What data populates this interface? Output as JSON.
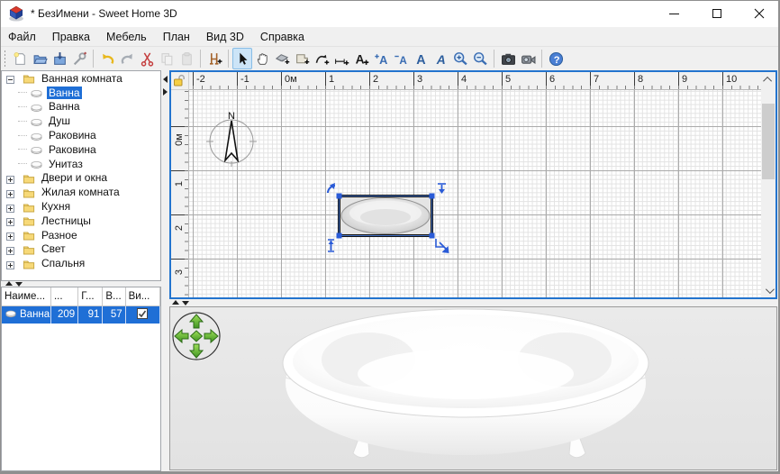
{
  "window": {
    "title": "* БезИмени - Sweet Home 3D"
  },
  "titlebar_controls": [
    {
      "name": "minimize-button",
      "icon": "minimize-icon"
    },
    {
      "name": "maximize-button",
      "icon": "maximize-icon"
    },
    {
      "name": "close-button",
      "icon": "close-icon"
    }
  ],
  "menu": {
    "items": [
      {
        "name": "menu-file",
        "label": "Файл"
      },
      {
        "name": "menu-edit",
        "label": "Правка"
      },
      {
        "name": "menu-furniture",
        "label": "Мебель"
      },
      {
        "name": "menu-plan",
        "label": "План"
      },
      {
        "name": "menu-view3d",
        "label": "Вид 3D"
      },
      {
        "name": "menu-help",
        "label": "Справка"
      }
    ]
  },
  "toolbar": {
    "buttons": [
      {
        "name": "new-home-button",
        "icon": "new-document-icon"
      },
      {
        "name": "open-home-button",
        "icon": "open-folder-icon"
      },
      {
        "name": "save-home-button",
        "icon": "save-icon"
      },
      {
        "name": "preferences-button",
        "icon": "preferences-icon"
      },
      {
        "separator": true
      },
      {
        "name": "undo-button",
        "icon": "undo-icon"
      },
      {
        "name": "redo-button",
        "icon": "redo-icon"
      },
      {
        "name": "cut-button",
        "icon": "cut-icon"
      },
      {
        "name": "copy-button",
        "icon": "copy-icon",
        "disabled": true
      },
      {
        "name": "paste-button",
        "icon": "paste-icon",
        "disabled": true
      },
      {
        "separator": true
      },
      {
        "name": "add-furniture-button",
        "icon": "add-furniture-icon"
      },
      {
        "separator": true
      },
      {
        "name": "select-tool-button",
        "icon": "select-arrow-icon",
        "active": true
      },
      {
        "name": "pan-tool-button",
        "icon": "pan-hand-icon"
      },
      {
        "name": "create-walls-button",
        "icon": "create-walls-icon"
      },
      {
        "name": "create-rooms-button",
        "icon": "create-rooms-icon"
      },
      {
        "name": "create-polylines-button",
        "icon": "create-polylines-icon"
      },
      {
        "name": "create-dimensions-button",
        "icon": "create-dimensions-icon"
      },
      {
        "name": "add-texts-button",
        "icon": "add-texts-icon"
      },
      {
        "name": "increase-text-size-button",
        "icon": "increase-text-icon"
      },
      {
        "name": "decrease-text-size-button",
        "icon": "decrease-text-icon"
      },
      {
        "name": "bold-button",
        "icon": "bold-icon"
      },
      {
        "name": "italic-button",
        "icon": "italic-icon"
      },
      {
        "name": "zoom-in-button",
        "icon": "zoom-in-icon"
      },
      {
        "name": "zoom-out-button",
        "icon": "zoom-out-icon"
      },
      {
        "separator": true
      },
      {
        "name": "photo-button",
        "icon": "camera-icon"
      },
      {
        "name": "video-button",
        "icon": "video-camera-icon"
      },
      {
        "separator": true
      },
      {
        "name": "help-button",
        "icon": "help-icon"
      }
    ]
  },
  "catalog": {
    "categories": [
      {
        "name": "category-bathroom",
        "label": "Ванная комната",
        "expanded": true,
        "items": [
          {
            "name": "item-bathtub-1",
            "icon": "bathtub-icon",
            "label": "Ванна",
            "selected": true
          },
          {
            "name": "item-bathtub-2",
            "icon": "bathtub-icon",
            "label": "Ванна"
          },
          {
            "name": "item-shower",
            "icon": "shower-icon",
            "label": "Душ"
          },
          {
            "name": "item-sink-1",
            "icon": "sink-icon",
            "label": "Раковина"
          },
          {
            "name": "item-sink-2",
            "icon": "sink-icon",
            "label": "Раковина"
          },
          {
            "name": "item-toilet",
            "icon": "toilet-icon",
            "label": "Унитаз"
          }
        ]
      },
      {
        "name": "category-doors-windows",
        "label": "Двери и окна",
        "expanded": false
      },
      {
        "name": "category-living-room",
        "label": "Жилая комната",
        "expanded": false
      },
      {
        "name": "category-kitchen",
        "label": "Кухня",
        "expanded": false
      },
      {
        "name": "category-staircases",
        "label": "Лестницы",
        "expanded": false
      },
      {
        "name": "category-miscellaneous",
        "label": "Разное",
        "expanded": false
      },
      {
        "name": "category-lights",
        "label": "Свет",
        "expanded": false
      },
      {
        "name": "category-bedroom",
        "label": "Спальня",
        "expanded": false
      }
    ]
  },
  "furniture_list": {
    "columns": [
      {
        "label": "Наиме..."
      },
      {
        "label": "..."
      },
      {
        "label": "Г..."
      },
      {
        "label": "В..."
      },
      {
        "label": "Ви..."
      }
    ],
    "rows": [
      {
        "name": "Ванна",
        "icon": "bathtub-icon",
        "width": "209",
        "depth": "91",
        "height": "57",
        "visible": true,
        "selected": true
      }
    ]
  },
  "plan": {
    "h_ruler_labels": [
      "-2",
      "-1",
      "0м",
      "1",
      "2",
      "3",
      "4",
      "5",
      "6",
      "7",
      "8",
      "9",
      "10"
    ],
    "v_ruler_labels": [
      "0м",
      "1",
      "2",
      "3"
    ],
    "compass_label": "N"
  },
  "colors": {
    "selection_blue": "#1f6fd6",
    "plan_border_blue": "#2374ce",
    "indicator_blue": "#2a5bd7",
    "toolbar_active_bg": "#cce4f7"
  }
}
